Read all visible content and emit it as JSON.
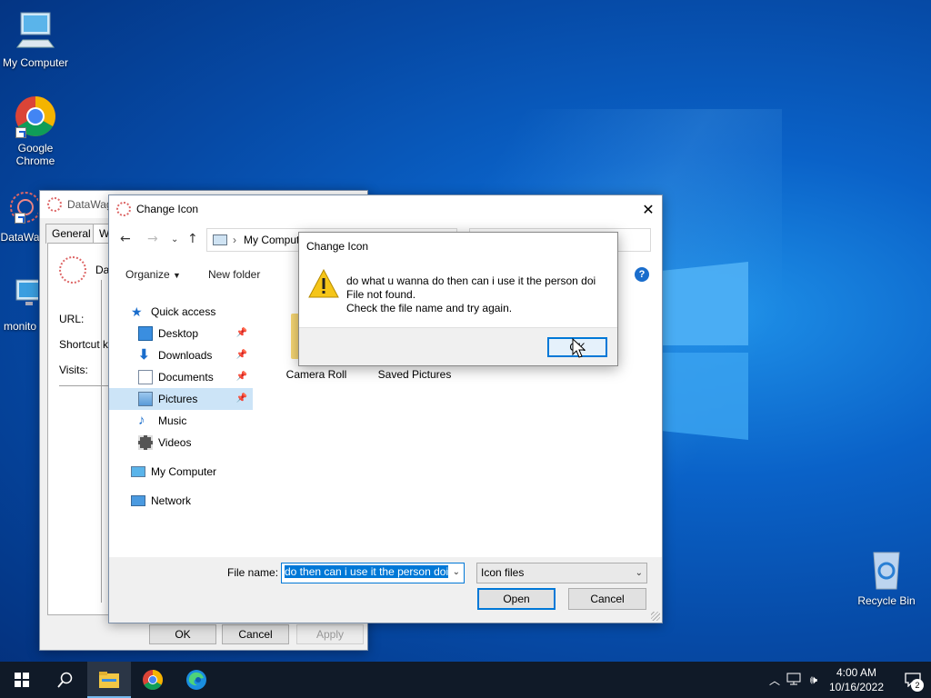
{
  "desktop": {
    "icons": [
      {
        "label": "My Computer"
      },
      {
        "label": "Google Chrome"
      },
      {
        "label": "DataWa"
      },
      {
        "label": "monito"
      },
      {
        "label": "Recycle Bin"
      }
    ]
  },
  "props_window": {
    "title": "DataWag",
    "tabs": [
      "General",
      "W"
    ],
    "header_text": "Da",
    "fields": {
      "url": "URL:",
      "shortcut": "Shortcut k",
      "visits": "Visits:"
    },
    "ok": "OK",
    "cancel": "Cancel",
    "apply": "Apply"
  },
  "file_dialog": {
    "title": "Change Icon",
    "address": "My Comput",
    "organize": "Organize",
    "new_folder": "New folder",
    "help": "?",
    "nav": {
      "quick_access": "Quick access",
      "desktop": "Desktop",
      "downloads": "Downloads",
      "documents": "Documents",
      "pictures": "Pictures",
      "music": "Music",
      "videos": "Videos",
      "my_computer": "My Computer",
      "network": "Network"
    },
    "folders": [
      "Camera Roll",
      "Saved Pictures"
    ],
    "file_name_label": "File name:",
    "file_name_value": "do then can i use it the person doi",
    "file_type": "Icon files",
    "open": "Open",
    "cancel": "Cancel"
  },
  "message_box": {
    "title": "Change Icon",
    "line1": "do what u wanna do then can i use it the person doi",
    "line2": "File not found.",
    "line3": "Check the file name and try again.",
    "ok": "OK"
  },
  "taskbar": {
    "time": "4:00 AM",
    "date": "10/16/2022",
    "notification_count": "2"
  }
}
